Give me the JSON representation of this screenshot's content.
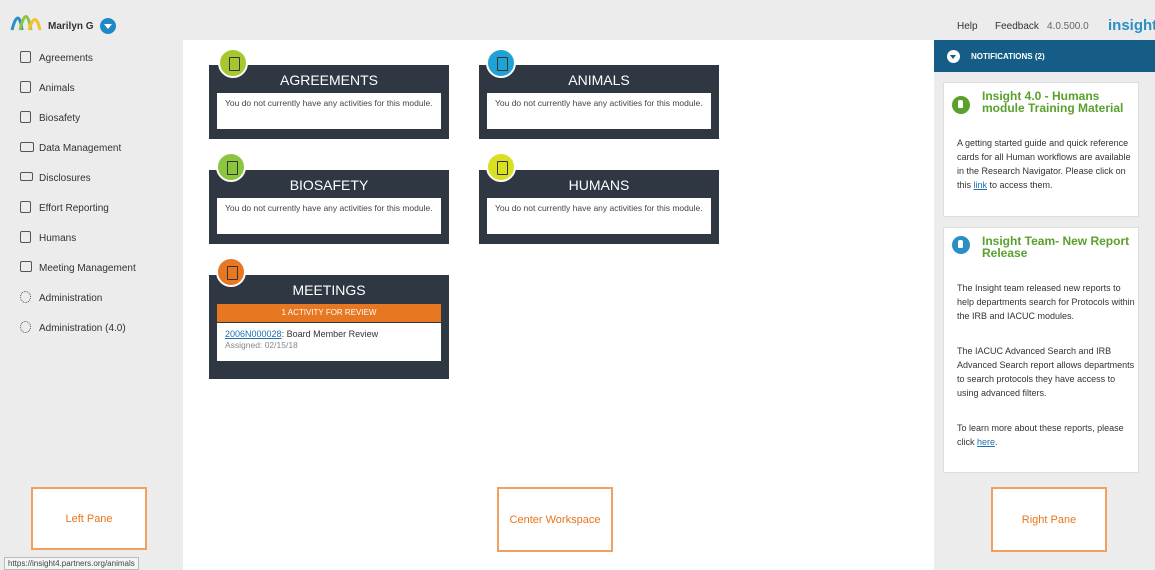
{
  "header": {
    "user_name": "Marilyn G",
    "help_label": "Help",
    "feedback_label": "Feedback",
    "version": "4.0.500.0",
    "brand": "insight"
  },
  "sidebar": {
    "items": [
      {
        "label": "Agreements",
        "icon": "document-icon"
      },
      {
        "label": "Animals",
        "icon": "paw-document-icon"
      },
      {
        "label": "Biosafety",
        "icon": "biohazard-document-icon"
      },
      {
        "label": "Data Management",
        "icon": "folder-open-icon"
      },
      {
        "label": "Disclosures",
        "icon": "monitor-icon"
      },
      {
        "label": "Effort Reporting",
        "icon": "report-icon"
      },
      {
        "label": "Humans",
        "icon": "person-document-icon"
      },
      {
        "label": "Meeting Management",
        "icon": "calendar-icon"
      },
      {
        "label": "Administration",
        "icon": "gear-icon"
      },
      {
        "label": "Administration (4.0)",
        "icon": "gear-icon"
      }
    ],
    "status_url": "https://insight4.partners.org/animals"
  },
  "cards": {
    "agreements": {
      "title": "AGREEMENTS",
      "body": "You do not currently have any activities for this module.",
      "icon_color": "#a6c82e"
    },
    "animals": {
      "title": "ANIMALS",
      "body": "You do not currently have any activities for this module.",
      "icon_color": "#1fa3d4"
    },
    "biosafety": {
      "title": "BIOSAFETY",
      "body": "You do not currently have any activities for this module.",
      "icon_color": "#8cc63f"
    },
    "humans": {
      "title": "HUMANS",
      "body": "You do not currently have any activities for this module.",
      "icon_color": "#d9e021"
    },
    "meetings": {
      "title": "MEETINGS",
      "review_label": "1 ACTIVITY FOR REVIEW",
      "item_id": "2006N000028",
      "item_title": ": Board Member Review",
      "assigned": "Assigned: 02/15/18",
      "icon_color": "#e87722"
    }
  },
  "pane_labels": {
    "left": "Left Pane",
    "center": "Center Workspace",
    "right": "Right Pane"
  },
  "notifications": {
    "title": "NOTIFICATIONS (2)",
    "items": [
      {
        "heading": "Insight 4.0 - Humans module Training Material",
        "text_before": "A getting started guide and quick reference cards for all Human workflows are available in the Research Navigator. Please click on this ",
        "link": "link",
        "text_after": " to access them.",
        "icon": "megaphone-icon"
      },
      {
        "heading": "Insight Team- New Report Release",
        "para1": "The Insight team released new reports to help departments search for Protocols within the IRB and IACUC modules.",
        "para2": "The IACUC Advanced Search and IRB Advanced Search report allows departments to search protocols they have access to using advanced filters.",
        "para3_before": "To learn more about these reports, please click ",
        "link": "here",
        "para3_after": ".",
        "icon": "bell-icon"
      }
    ]
  }
}
